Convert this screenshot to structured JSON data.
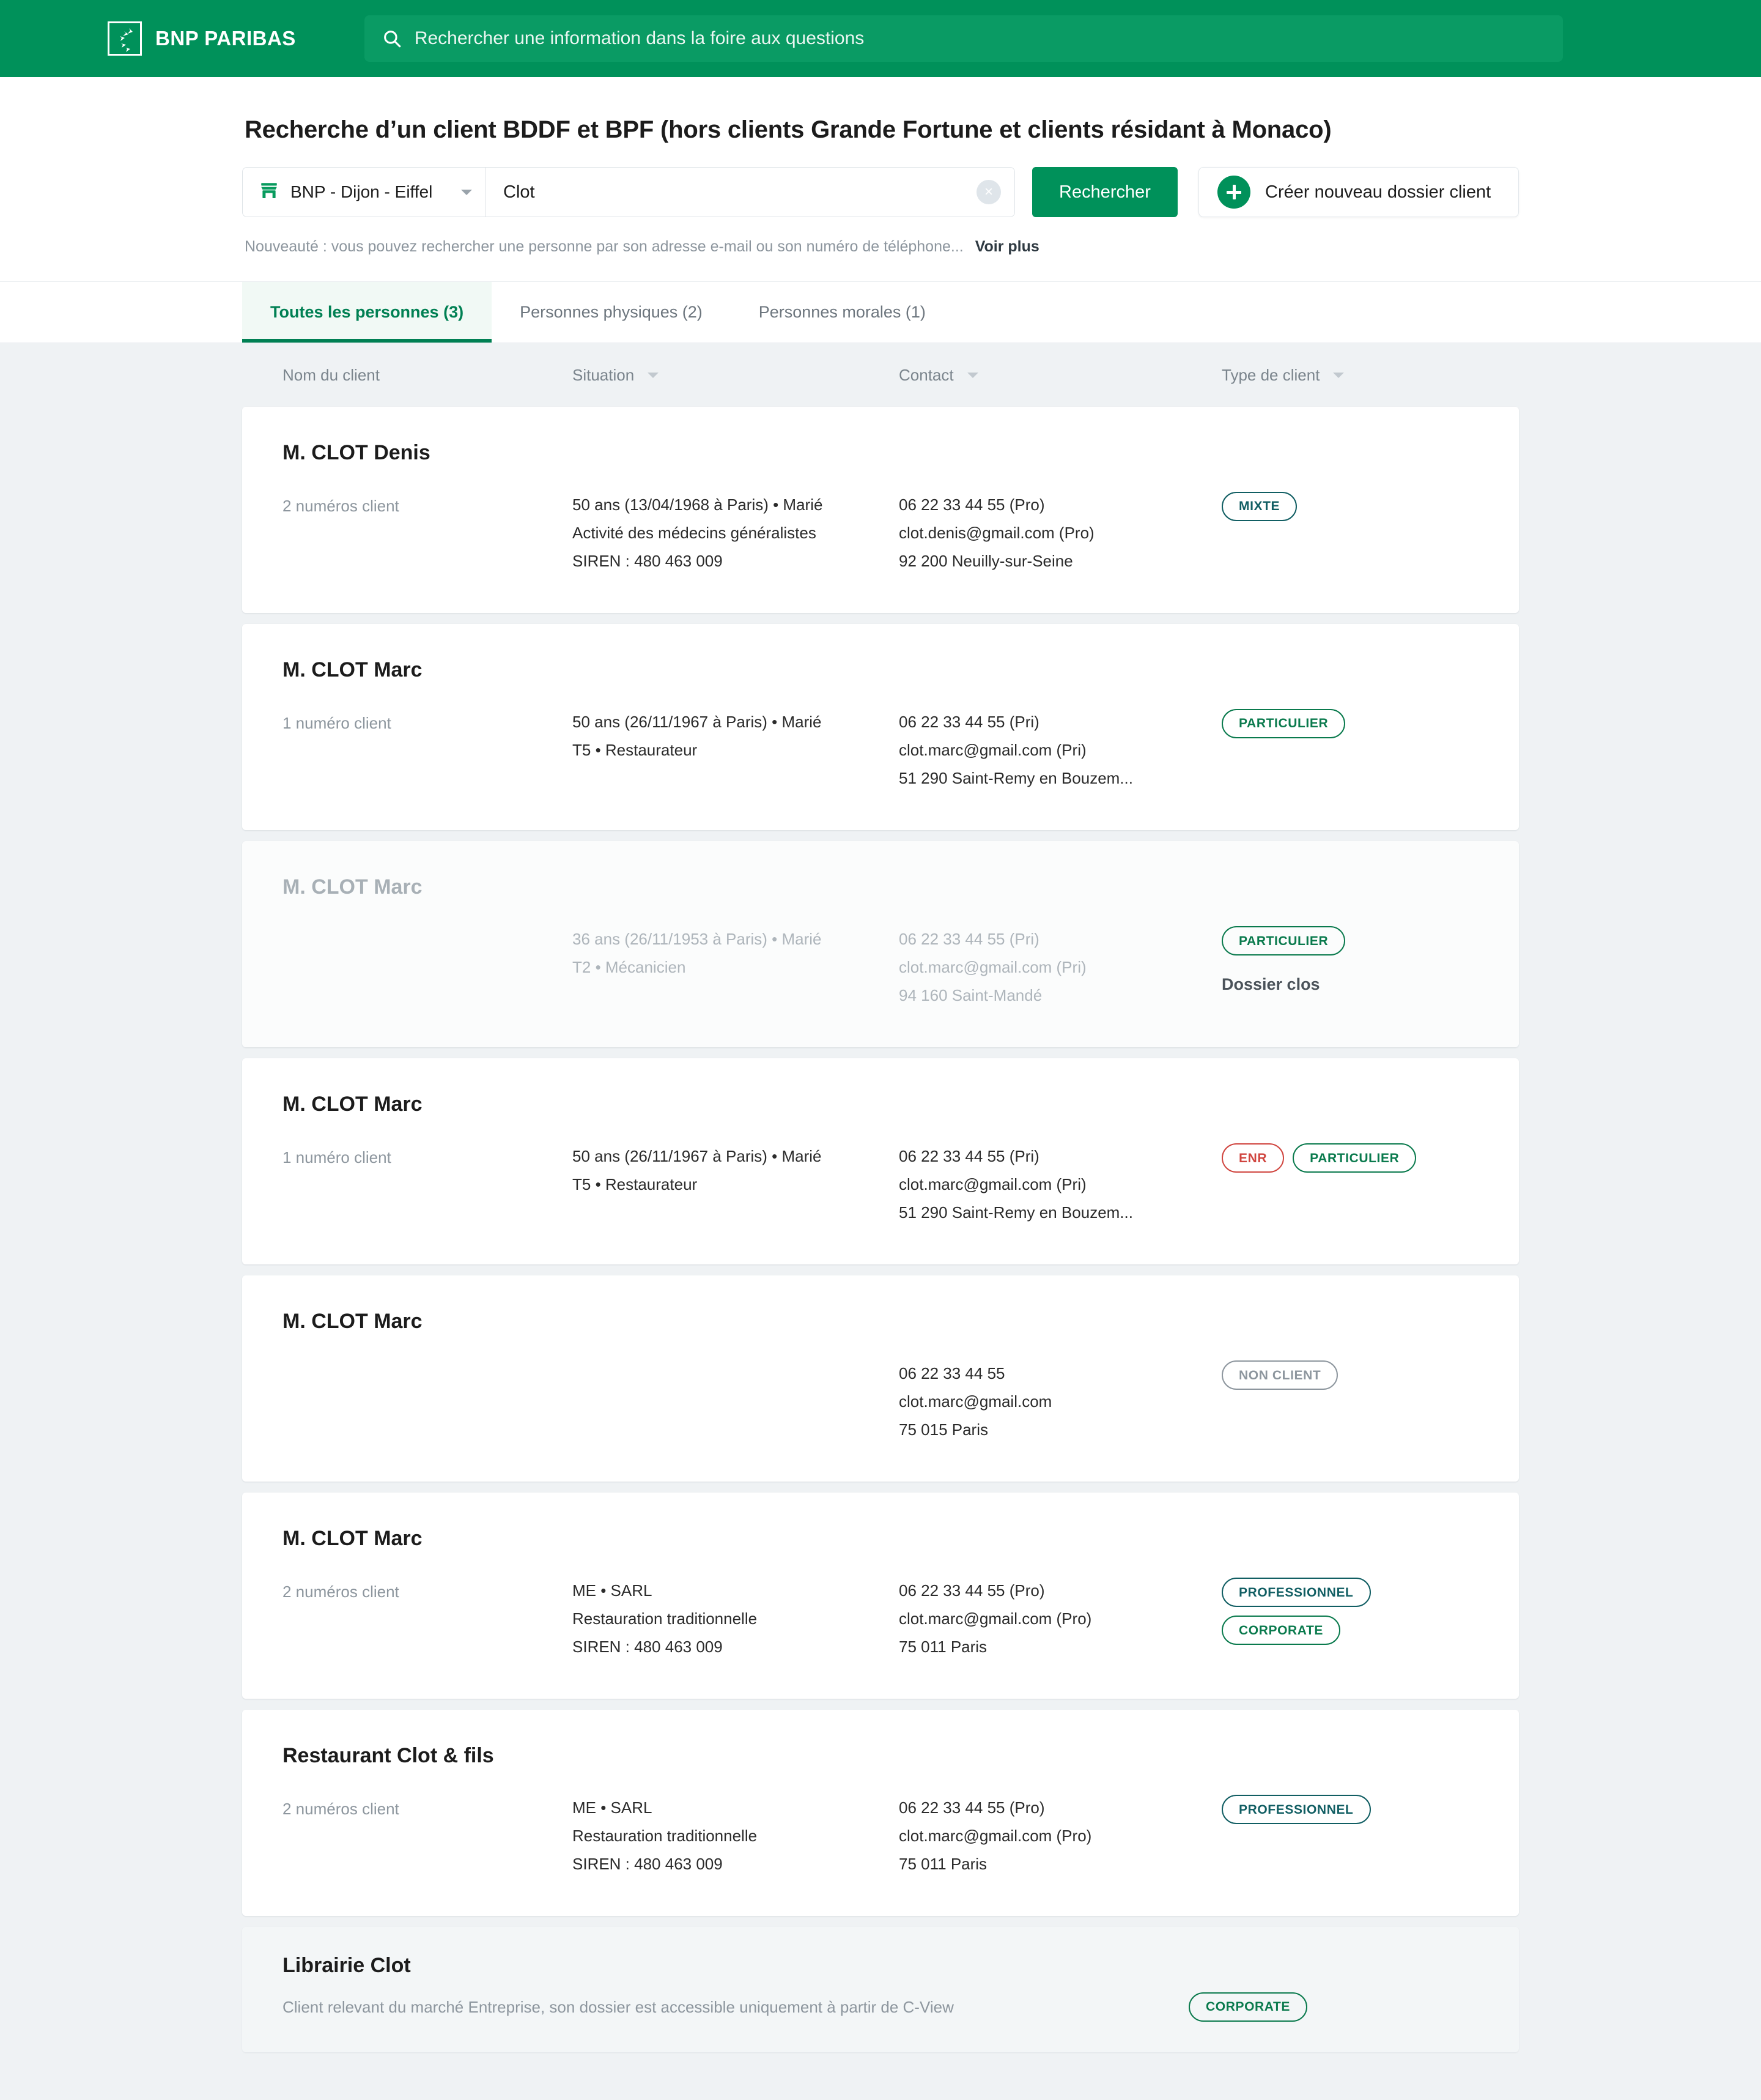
{
  "brand": {
    "name": "BNP PARIBAS",
    "logo_icon": "bnp-star-logo",
    "bar_color": "#00915a"
  },
  "faq_search": {
    "icon": "search-icon",
    "placeholder": "Rechercher une information dans la foire aux questions",
    "value": ""
  },
  "page": {
    "title": "Recherche d’un client BDDF et BPF (hors clients Grande Fortune et clients résidant à Monaco)"
  },
  "search_form": {
    "agency": {
      "icon": "store-icon",
      "label": "BNP - Dijon - Eiffel",
      "caret_icon": "chevron-down-icon"
    },
    "query": {
      "value": "Clot",
      "placeholder": "",
      "clear_icon": "close-circle-icon",
      "clear_glyph": "×"
    },
    "search_button": "Rechercher",
    "create_button": {
      "icon": "plus-circle-icon",
      "label": "Créer nouveau dossier client"
    },
    "hint": "Nouveauté : vous pouvez rechercher une personne par son adresse e-mail ou son numéro de téléphone...",
    "hint_link": "Voir plus"
  },
  "tabs": [
    {
      "label": "Toutes les personnes (3)",
      "active": true
    },
    {
      "label": "Personnes physiques (2)",
      "active": false
    },
    {
      "label": "Personnes morales (1)",
      "active": false
    }
  ],
  "columns": [
    {
      "label": "Nom du client",
      "sortable": false
    },
    {
      "label": "Situation",
      "sortable": true
    },
    {
      "label": "Contact",
      "sortable": true
    },
    {
      "label": "Type de client",
      "sortable": true
    }
  ],
  "colors": {
    "brand_green": "#00915a",
    "badge_green": "#0a7a4d",
    "badge_teal": "#115e63",
    "badge_red": "#d0453f",
    "badge_grey": "#8d969e",
    "page_bg": "#eff2f4"
  },
  "results": [
    {
      "name": "M. CLOT Denis",
      "client_numbers": "2 numéros client",
      "situation": [
        "50 ans (13/04/1968 à Paris) • Marié",
        "Activité des médecins généralistes",
        "SIREN : 480 463 009"
      ],
      "contact": [
        "06 22 33 44 55 (Pro)",
        "clot.denis@gmail.com (Pro)",
        "92 200 Neuilly-sur-Seine"
      ],
      "badges": [
        {
          "label": "MIXTE",
          "color": "#115e63"
        }
      ],
      "muted": false,
      "closed_note": ""
    },
    {
      "name": "M. CLOT Marc",
      "client_numbers": "1 numéro client",
      "situation": [
        "50 ans (26/11/1967 à Paris) • Marié",
        "T5 • Restaurateur"
      ],
      "contact": [
        "06 22 33 44 55 (Pri)",
        "clot.marc@gmail.com (Pri)",
        "51 290 Saint-Remy en Bouzem..."
      ],
      "badges": [
        {
          "label": "PARTICULIER",
          "color": "#0a7a4d"
        }
      ],
      "muted": false,
      "closed_note": ""
    },
    {
      "name": "M. CLOT Marc",
      "client_numbers": "",
      "situation": [
        "36 ans (26/11/1953 à Paris) • Marié",
        "T2 • Mécanicien"
      ],
      "contact": [
        "06 22 33 44 55 (Pri)",
        "clot.marc@gmail.com (Pri)",
        "94 160 Saint-Mandé"
      ],
      "badges": [
        {
          "label": "PARTICULIER",
          "color": "#0a7a4d"
        }
      ],
      "muted": true,
      "closed_note": "Dossier clos"
    },
    {
      "name": "M. CLOT Marc",
      "client_numbers": "1 numéro client",
      "situation": [
        "50 ans (26/11/1967 à Paris) • Marié",
        "T5 • Restaurateur"
      ],
      "contact": [
        "06 22 33 44 55 (Pri)",
        "clot.marc@gmail.com (Pri)",
        "51 290 Saint-Remy en Bouzem..."
      ],
      "badges": [
        {
          "label": "ENR",
          "color": "#d0453f"
        },
        {
          "label": "PARTICULIER",
          "color": "#0a7a4d"
        }
      ],
      "muted": false,
      "closed_note": ""
    },
    {
      "name": "M. CLOT Marc",
      "client_numbers": "",
      "situation": [],
      "contact": [
        "06 22 33 44 55",
        "clot.marc@gmail.com",
        "75 015 Paris"
      ],
      "badges": [
        {
          "label": "NON CLIENT",
          "color": "#8d969e"
        }
      ],
      "muted": false,
      "closed_note": ""
    },
    {
      "name": "M. CLOT Marc",
      "client_numbers": "2 numéros client",
      "situation": [
        "ME • SARL",
        "Restauration traditionnelle",
        "SIREN : 480 463 009"
      ],
      "contact": [
        "06 22 33 44 55 (Pro)",
        "clot.marc@gmail.com (Pro)",
        "75 011 Paris"
      ],
      "badges": [
        {
          "label": "PROFESSIONNEL",
          "color": "#115e63"
        },
        {
          "label": "CORPORATE",
          "color": "#0a7a4d"
        }
      ],
      "muted": false,
      "closed_note": ""
    },
    {
      "name": "Restaurant Clot & fils",
      "client_numbers": "2 numéros client",
      "situation": [
        "ME • SARL",
        "Restauration traditionnelle",
        "SIREN : 480 463 009"
      ],
      "contact": [
        "06 22 33 44 55 (Pro)",
        "clot.marc@gmail.com (Pro)",
        "75 011 Paris"
      ],
      "badges": [
        {
          "label": "PROFESSIONNEL",
          "color": "#115e63"
        }
      ],
      "muted": false,
      "closed_note": ""
    }
  ],
  "last_result": {
    "name": "Librairie Clot",
    "subtitle": "Client relevant du marché Entreprise, son dossier est accessible uniquement à partir de C-View",
    "badge": {
      "label": "CORPORATE",
      "color": "#0a7a4d"
    }
  }
}
